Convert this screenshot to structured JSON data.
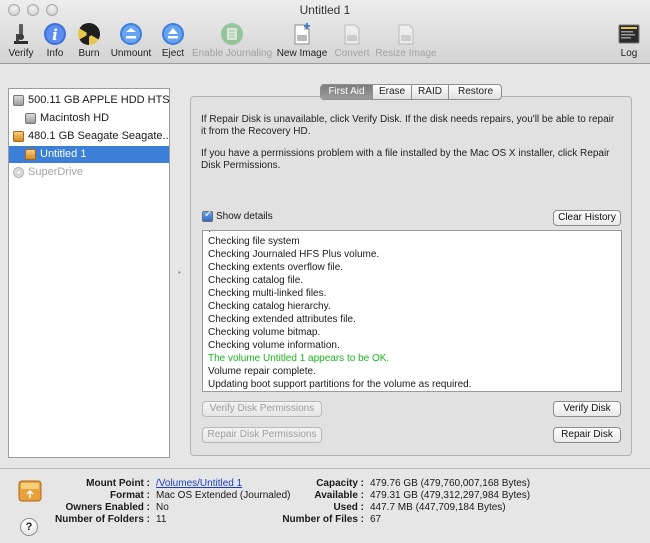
{
  "window": {
    "title": "Untitled 1"
  },
  "toolbar": [
    {
      "key": "verify",
      "label": "Verify",
      "icon": "microscope-icon",
      "enabled": true
    },
    {
      "key": "info",
      "label": "Info",
      "icon": "info-icon",
      "enabled": true
    },
    {
      "key": "burn",
      "label": "Burn",
      "icon": "burn-icon",
      "enabled": true
    },
    {
      "key": "unmount",
      "label": "Unmount",
      "icon": "unmount-icon",
      "enabled": true
    },
    {
      "key": "eject",
      "label": "Eject",
      "icon": "eject-icon",
      "enabled": true
    },
    {
      "key": "enable_journaling",
      "label": "Enable Journaling",
      "icon": "journaling-icon",
      "enabled": false
    },
    {
      "key": "new_image",
      "label": "New Image",
      "icon": "new-image-icon",
      "enabled": true
    },
    {
      "key": "convert",
      "label": "Convert",
      "icon": "convert-icon",
      "enabled": false
    },
    {
      "key": "resize_image",
      "label": "Resize Image",
      "icon": "resize-image-icon",
      "enabled": false
    },
    {
      "key": "log",
      "label": "Log",
      "icon": "log-icon",
      "enabled": true
    }
  ],
  "sidebar": {
    "items": [
      {
        "label": "500.11 GB APPLE HDD HTS...",
        "level": 0,
        "selected": false,
        "disabled": false
      },
      {
        "label": "Macintosh HD",
        "level": 1,
        "selected": false,
        "disabled": false
      },
      {
        "label": "480.1 GB Seagate Seagate...",
        "level": 0,
        "selected": false,
        "disabled": false
      },
      {
        "label": "Untitled 1",
        "level": 1,
        "selected": true,
        "disabled": false
      },
      {
        "label": "SuperDrive",
        "level": 0,
        "selected": false,
        "disabled": true
      }
    ]
  },
  "tabs": [
    {
      "label": "First Aid",
      "active": true
    },
    {
      "label": "Erase",
      "active": false
    },
    {
      "label": "RAID",
      "active": false
    },
    {
      "label": "Restore",
      "active": false
    }
  ],
  "first_aid": {
    "info_1": "If Repair Disk is unavailable, click Verify Disk. If the disk needs repairs, you'll be able to repair it from the Recovery HD.",
    "info_2": "If you have a permissions problem with a file installed by the Mac OS X installer, click Repair Disk Permissions.",
    "show_details_label": "Show details",
    "show_details_checked": true,
    "clear_history_label": "Clear History",
    "log_lines": [
      {
        "text": "Checking file system",
        "ok": false
      },
      {
        "text": "Checking Journaled HFS Plus volume.",
        "ok": false
      },
      {
        "text": "Checking extents overflow file.",
        "ok": false
      },
      {
        "text": "Checking catalog file.",
        "ok": false
      },
      {
        "text": "Checking multi-linked files.",
        "ok": false
      },
      {
        "text": "Checking catalog hierarchy.",
        "ok": false
      },
      {
        "text": "Checking extended attributes file.",
        "ok": false
      },
      {
        "text": "Checking volume bitmap.",
        "ok": false
      },
      {
        "text": "Checking volume information.",
        "ok": false
      },
      {
        "text": "The volume Untitled 1 appears to be OK.",
        "ok": true
      },
      {
        "text": "Volume repair complete.",
        "ok": false
      },
      {
        "text": "Updating boot support partitions for the volume as required.",
        "ok": false
      }
    ],
    "verify_permissions_label": "Verify Disk Permissions",
    "repair_permissions_label": "Repair Disk Permissions",
    "verify_disk_label": "Verify Disk",
    "repair_disk_label": "Repair Disk"
  },
  "details": {
    "mount_point_key": "Mount Point :",
    "mount_point_val": "/Volumes/Untitled 1",
    "format_key": "Format :",
    "format_val": "Mac OS Extended (Journaled)",
    "owners_key": "Owners Enabled :",
    "owners_val": "No",
    "folders_key": "Number of Folders :",
    "folders_val": "11",
    "capacity_key": "Capacity :",
    "capacity_val": "479.76 GB (479,760,007,168 Bytes)",
    "available_key": "Available :",
    "available_val": "479.31 GB (479,312,297,984 Bytes)",
    "used_key": "Used :",
    "used_val": "447.7 MB (447,709,184 Bytes)",
    "files_key": "Number of Files :",
    "files_val": "67"
  },
  "help": {
    "label": "?"
  },
  "colors": {
    "selection": "#3b7fd8",
    "ok_text": "#19b51d",
    "link": "#1b3fc4"
  }
}
